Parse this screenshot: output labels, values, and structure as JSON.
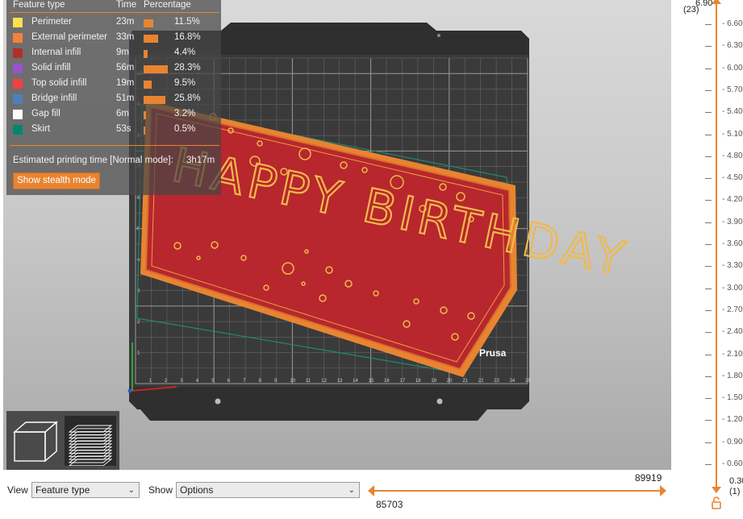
{
  "legend": {
    "header": {
      "feature": "Feature type",
      "time": "Time",
      "percentage": "Percentage"
    },
    "rows": [
      {
        "name": "Perimeter",
        "time": "23m",
        "percent": "11.5%",
        "value": 11.5,
        "color": "#ffe04d"
      },
      {
        "name": "External perimeter",
        "time": "33m",
        "percent": "16.8%",
        "value": 16.8,
        "color": "#f5813c"
      },
      {
        "name": "Internal infill",
        "time": "9m",
        "percent": "4.4%",
        "value": 4.4,
        "color": "#b03029"
      },
      {
        "name": "Solid infill",
        "time": "56m",
        "percent": "28.3%",
        "value": 28.3,
        "color": "#9654cc"
      },
      {
        "name": "Top solid infill",
        "time": "19m",
        "percent": "9.5%",
        "value": 9.5,
        "color": "#f04040"
      },
      {
        "name": "Bridge infill",
        "time": "51m",
        "percent": "25.8%",
        "value": 25.8,
        "color": "#4d80ba"
      },
      {
        "name": "Gap fill",
        "time": "6m",
        "percent": "3.2%",
        "value": 3.2,
        "color": "#ffffff"
      },
      {
        "name": "Skirt",
        "time": "53s",
        "percent": "0.5%",
        "value": 0.5,
        "color": "#00876e"
      }
    ],
    "estimate_label": "Estimated printing time [Normal mode]:",
    "estimate_value": "3h17m",
    "stealth_button": "Show stealth mode"
  },
  "scene": {
    "model_text": "HAPPY BIRTHDAY",
    "bed_brand": "Prusa",
    "bed_x_ticks": [
      "1",
      "2",
      "3",
      "4",
      "5",
      "6",
      "7",
      "8",
      "9",
      "10",
      "11",
      "12",
      "13",
      "14",
      "15",
      "16",
      "17",
      "18",
      "19",
      "20",
      "21",
      "22",
      "23",
      "24",
      "25"
    ],
    "bed_y_ticks": [
      "1",
      "2",
      "3",
      "4",
      "5",
      "6",
      "7",
      "8",
      "9",
      "10"
    ],
    "model_fill_color": "#b8262e",
    "model_edge_color": "#e88431",
    "bed_color": "#2f2f2f"
  },
  "bottom": {
    "view_label": "View",
    "view_value": "Feature type",
    "show_label": "Show",
    "show_value": "Options",
    "range_upper": "89919",
    "range_lower": "85703"
  },
  "layer_slider": {
    "top_value": "6.90",
    "top_layer": "(23)",
    "bottom_value": "0.30",
    "bottom_layer": "(1)",
    "ticks": [
      "6.60",
      "6.30",
      "6.00",
      "5.70",
      "5.40",
      "5.10",
      "4.80",
      "4.50",
      "4.20",
      "3.90",
      "3.60",
      "3.30",
      "3.00",
      "2.70",
      "2.40",
      "2.10",
      "1.80",
      "1.50",
      "1.20",
      "0.90",
      "0.60"
    ],
    "accent_color": "#e88431"
  }
}
